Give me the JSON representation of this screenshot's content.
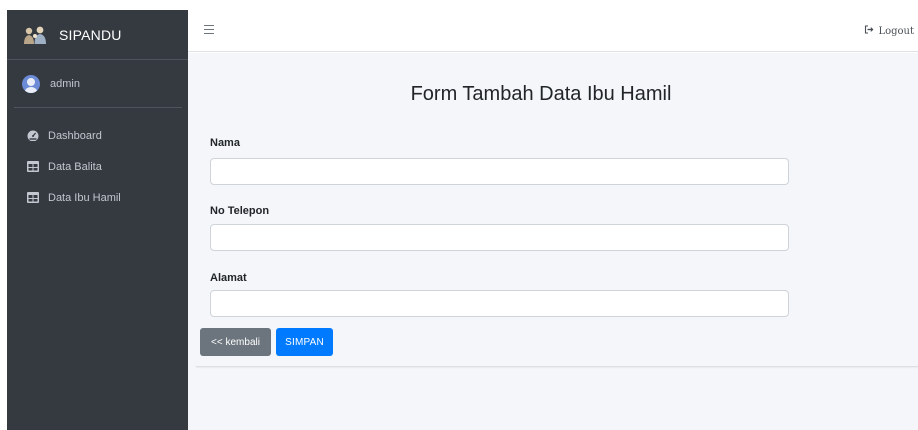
{
  "brand": {
    "name": "SIPANDU",
    "logo_icon": "family-logo-icon"
  },
  "user": {
    "name": "admin",
    "avatar_icon": "user-circle-icon"
  },
  "sidebar": {
    "items": [
      {
        "label": "Dashboard",
        "icon": "tachometer-icon"
      },
      {
        "label": "Data Balita",
        "icon": "table-icon"
      },
      {
        "label": "Data Ibu Hamil",
        "icon": "table-icon"
      }
    ]
  },
  "topbar": {
    "menu_icon": "hamburger-icon",
    "logout_label": "Logout",
    "logout_icon": "sign-out-icon"
  },
  "form": {
    "title": "Form Tambah Data Ibu Hamil",
    "fields": [
      {
        "label": "Nama",
        "value": ""
      },
      {
        "label": "No Telepon",
        "value": ""
      },
      {
        "label": "Alamat",
        "value": ""
      }
    ],
    "back_label": "<< kembali",
    "save_label": "SIMPAN"
  },
  "colors": {
    "sidebar_bg": "#343a40",
    "content_bg": "#f4f6f9",
    "primary": "#007bff",
    "secondary": "#6c757d"
  }
}
